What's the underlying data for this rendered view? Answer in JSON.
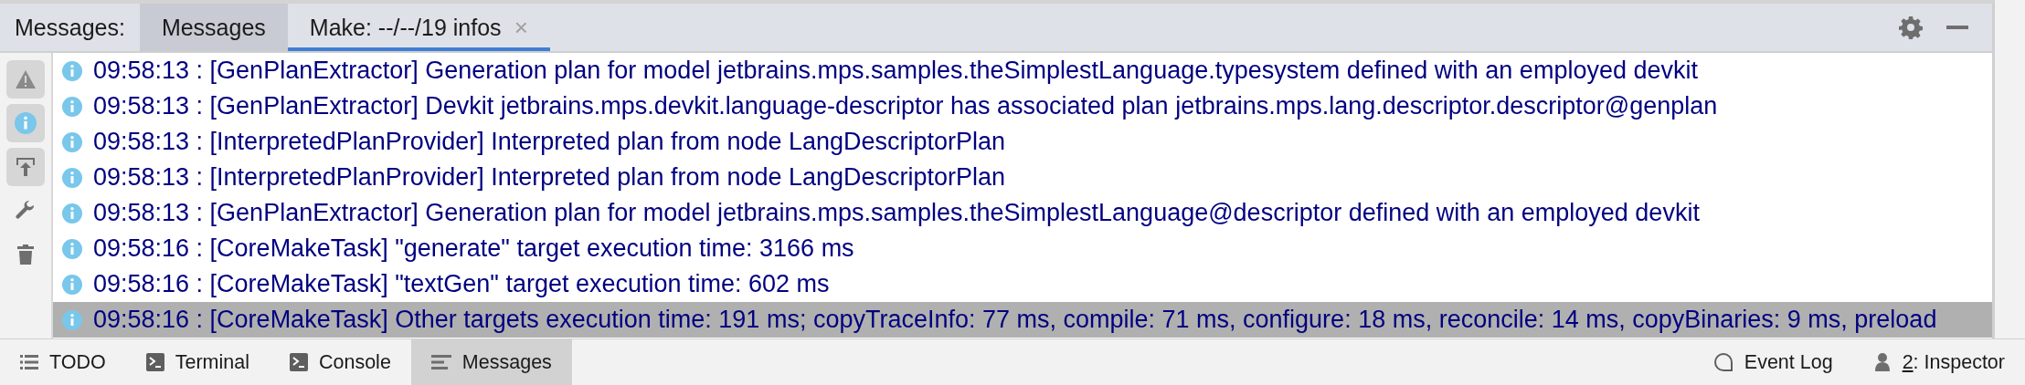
{
  "header": {
    "label": "Messages:",
    "tabs": [
      {
        "label": "Messages",
        "selected": false,
        "hovered": true
      },
      {
        "label": "Make: --/--/19 infos",
        "selected": true,
        "hovered": false,
        "close": "×"
      }
    ]
  },
  "toolbar": [
    {
      "kind": "warning",
      "on": true
    },
    {
      "kind": "info",
      "on": true
    },
    {
      "kind": "autoscroll",
      "on": true
    },
    {
      "kind": "wrench",
      "on": false
    },
    {
      "kind": "trash",
      "on": false
    }
  ],
  "messages": [
    {
      "text": "09:58:13 : [GenPlanExtractor] Generation plan for model jetbrains.mps.samples.theSimplestLanguage.typesystem defined with an employed devkit",
      "selected": false
    },
    {
      "text": "09:58:13 : [GenPlanExtractor] Devkit jetbrains.mps.devkit.language-descriptor has associated plan jetbrains.mps.lang.descriptor.descriptor@genplan",
      "selected": false
    },
    {
      "text": "09:58:13 : [InterpretedPlanProvider] Interpreted plan from node LangDescriptorPlan",
      "selected": false
    },
    {
      "text": "09:58:13 : [InterpretedPlanProvider] Interpreted plan from node LangDescriptorPlan",
      "selected": false
    },
    {
      "text": "09:58:13 : [GenPlanExtractor] Generation plan for model jetbrains.mps.samples.theSimplestLanguage@descriptor defined with an employed devkit",
      "selected": false
    },
    {
      "text": "09:58:16 : [CoreMakeTask] \"generate\" target execution time: 3166 ms",
      "selected": false
    },
    {
      "text": "09:58:16 : [CoreMakeTask] \"textGen\" target execution time: 602 ms",
      "selected": false
    },
    {
      "text": "09:58:16 : [CoreMakeTask] Other targets execution time: 191 ms; copyTraceInfo: 77 ms, compile: 71 ms, configure: 18 ms, reconcile: 14 ms, copyBinaries: 9 ms, preload",
      "selected": true
    }
  ],
  "bottom_tabs": [
    {
      "kind": "list",
      "label": "TODO",
      "selected": false
    },
    {
      "kind": "terminal",
      "label": "Terminal",
      "selected": false
    },
    {
      "kind": "terminal",
      "label": "Console",
      "selected": false
    },
    {
      "kind": "messages",
      "label": "Messages",
      "selected": true
    }
  ],
  "bottom_right": [
    {
      "kind": "eventlog",
      "label": "Event Log"
    },
    {
      "kind": "inspector",
      "mnemonic": "2",
      "label": ": Inspector"
    }
  ]
}
